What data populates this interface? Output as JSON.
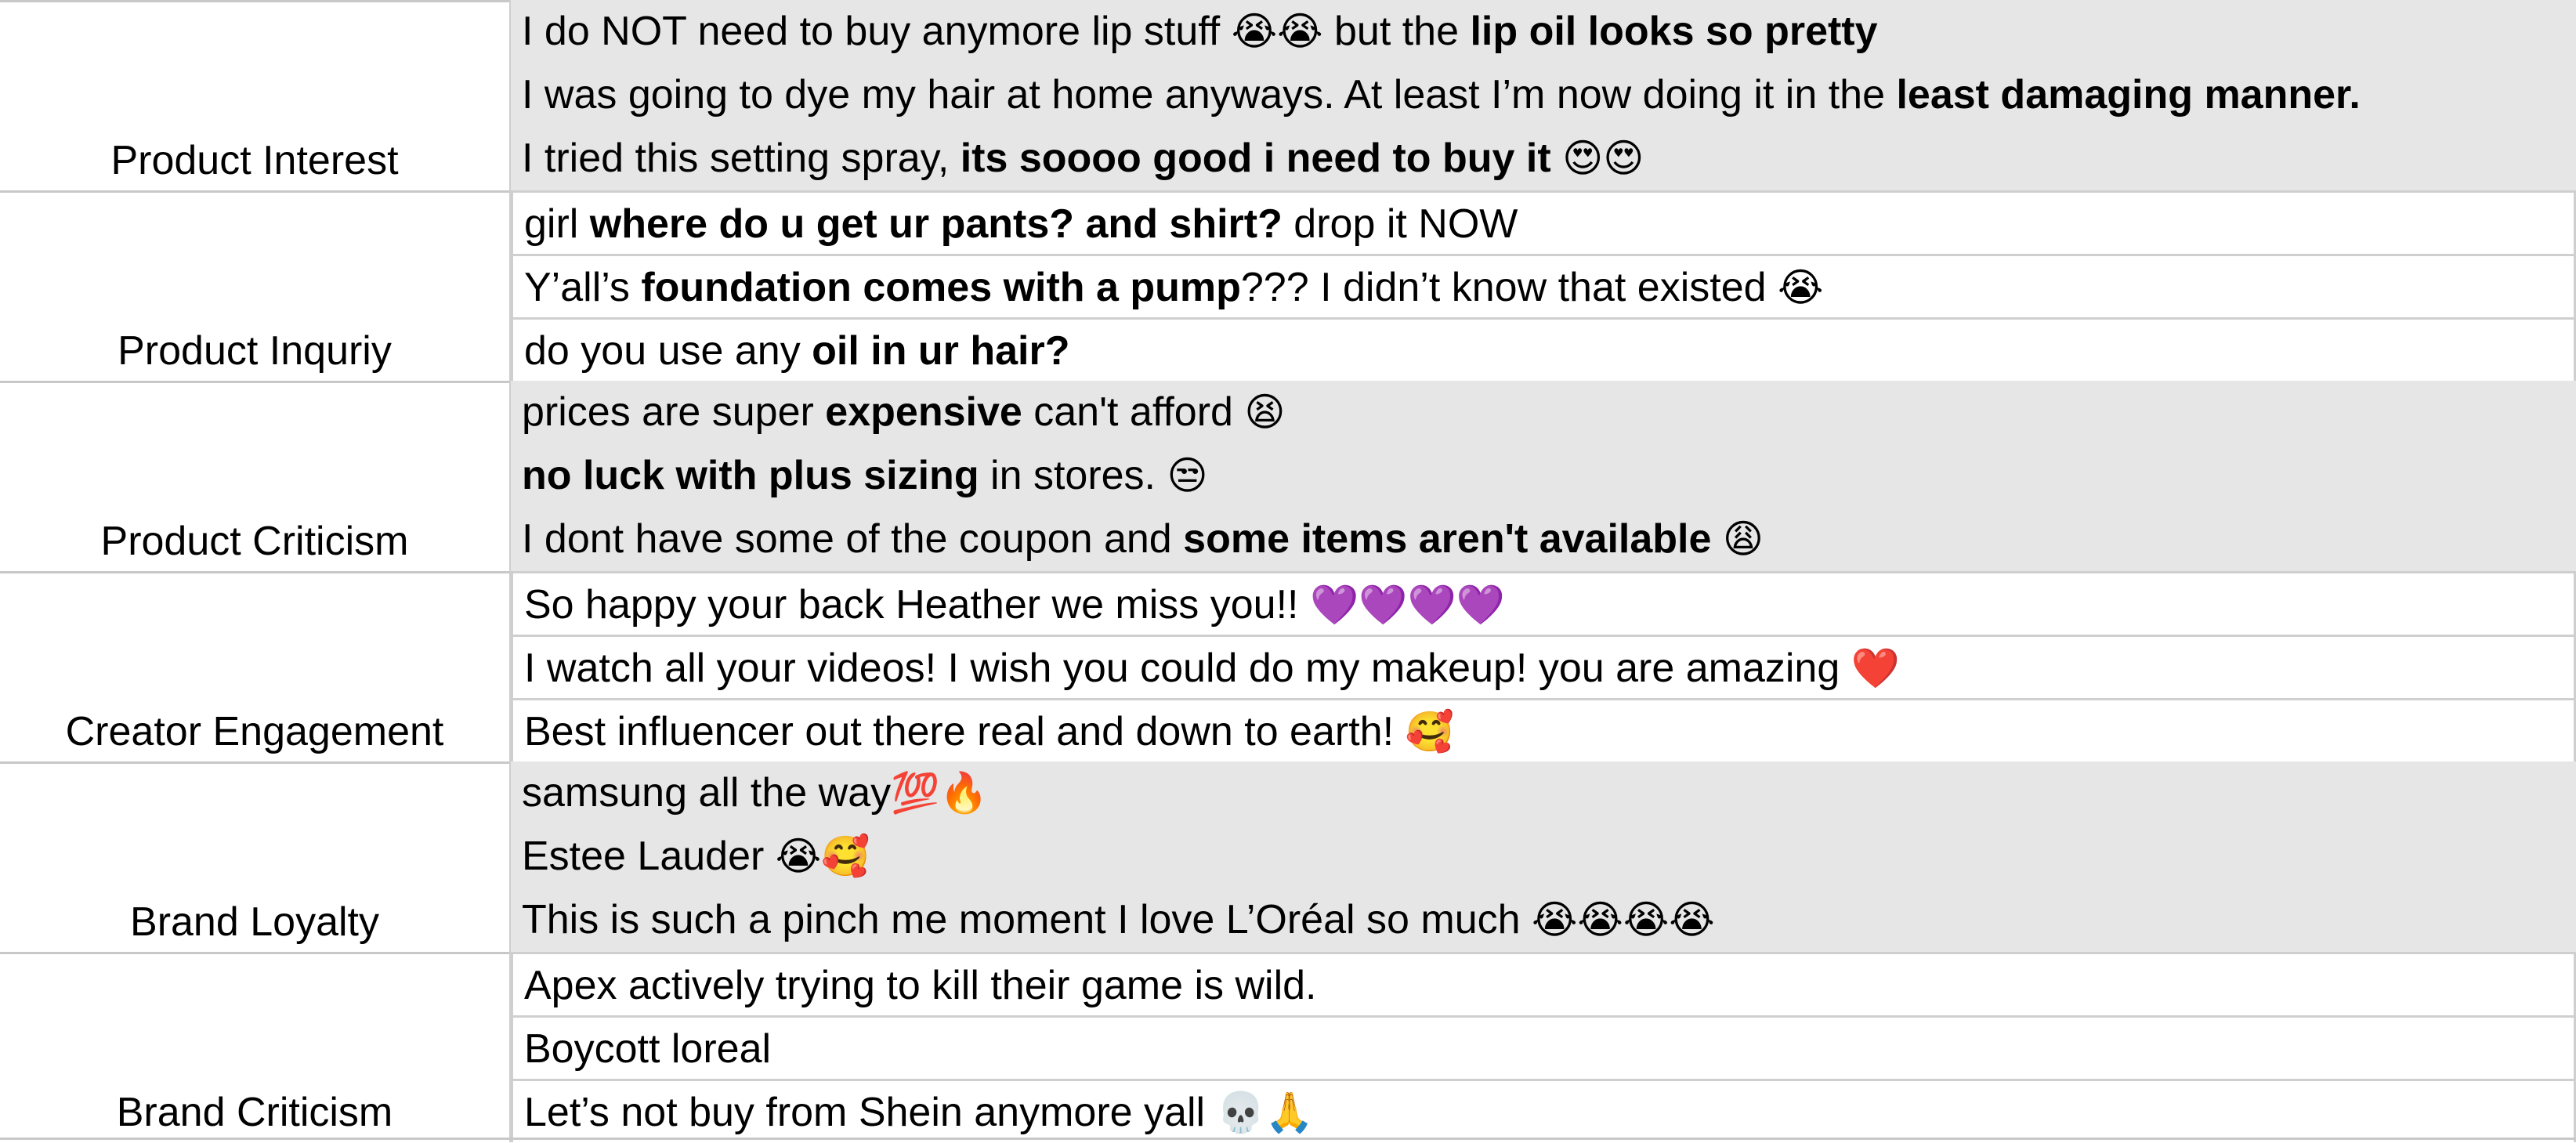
{
  "groups": [
    {
      "category": "Product Interest",
      "shaded": true,
      "rows": [
        [
          {
            "t": "I do NOT need to buy anymore lip stuff "
          },
          {
            "t": "😭😭",
            "e": true
          },
          {
            "t": " but the "
          },
          {
            "t": "lip oil looks so pretty",
            "b": true
          }
        ],
        [
          {
            "t": "I was going to dye my hair at home anyways. At least I’m now doing it in the "
          },
          {
            "t": "least damaging manner.",
            "b": true
          }
        ],
        [
          {
            "t": "I tried this setting spray, "
          },
          {
            "t": "its soooo good i need to buy it",
            "b": true
          },
          {
            "t": " "
          },
          {
            "t": "😍😍",
            "e": true
          }
        ]
      ]
    },
    {
      "category": "Product Inquriy",
      "shaded": false,
      "rows": [
        [
          {
            "t": "girl "
          },
          {
            "t": "where do u get ur pants? and shirt?",
            "b": true
          },
          {
            "t": " drop it NOW"
          }
        ],
        [
          {
            "t": "Y’all’s "
          },
          {
            "t": "foundation comes with a pump",
            "b": true
          },
          {
            "t": "??? I didn’t know that existed "
          },
          {
            "t": "😭",
            "e": true
          }
        ],
        [
          {
            "t": "do you use any "
          },
          {
            "t": "oil in ur hair?",
            "b": true
          }
        ]
      ]
    },
    {
      "category": "Product Criticism",
      "shaded": true,
      "rows": [
        [
          {
            "t": "prices are super "
          },
          {
            "t": "expensive",
            "b": true
          },
          {
            "t": " can't afford "
          },
          {
            "t": "😫",
            "e": true
          }
        ],
        [
          {
            "t": "no luck with plus sizing",
            "b": true
          },
          {
            "t": " in stores. "
          },
          {
            "t": "😒",
            "e": true
          }
        ],
        [
          {
            "t": "I dont have some of the coupon and "
          },
          {
            "t": "some items aren't available",
            "b": true
          },
          {
            "t": " "
          },
          {
            "t": "😩",
            "e": true
          }
        ]
      ]
    },
    {
      "category": "Creator Engagement",
      "shaded": false,
      "rows": [
        [
          {
            "t": "So happy your back Heather we miss you!! "
          },
          {
            "t": "💜💜💜💜",
            "e": true
          }
        ],
        [
          {
            "t": "I watch all your videos! I wish you could do my makeup! you are amazing "
          },
          {
            "t": "❤️",
            "e": true
          }
        ],
        [
          {
            "t": "Best influencer out there real and down to earth! "
          },
          {
            "t": "🥰",
            "e": true
          }
        ]
      ]
    },
    {
      "category": "Brand Loyalty",
      "shaded": true,
      "rows": [
        [
          {
            "t": "samsung all the way"
          },
          {
            "t": "💯🔥",
            "e": true
          }
        ],
        [
          {
            "t": "Estee Lauder "
          },
          {
            "t": "😭🥰",
            "e": true
          }
        ],
        [
          {
            "t": "This is such a pinch me moment I love L’Oréal so much "
          },
          {
            "t": "😭😭😭😭",
            "e": true
          }
        ]
      ]
    },
    {
      "category": "Brand Criticism",
      "shaded": false,
      "rows": [
        [
          {
            "t": "Apex actively trying to kill their game is wild."
          }
        ],
        [
          {
            "t": "Boycott loreal"
          }
        ],
        [
          {
            "t": "Let’s not buy from Shein anymore yall "
          },
          {
            "t": "💀🙏",
            "e": true
          }
        ]
      ]
    }
  ]
}
